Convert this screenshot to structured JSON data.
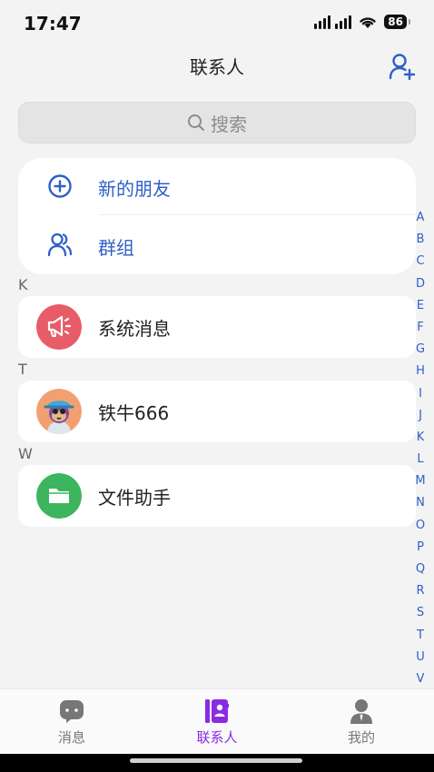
{
  "status": {
    "time": "17:47",
    "battery": "86"
  },
  "header": {
    "title": "联系人"
  },
  "search": {
    "placeholder": "搜索"
  },
  "top_items": [
    {
      "label": "新的朋友",
      "icon": "plus-circle-icon"
    },
    {
      "label": "群组",
      "icon": "group-icon"
    }
  ],
  "sections": [
    {
      "letter": "K",
      "contacts": [
        {
          "name": "系统消息",
          "avatar": "megaphone-avatar",
          "color": "#e85c67"
        }
      ]
    },
    {
      "letter": "T",
      "contacts": [
        {
          "name": "铁牛666",
          "avatar": "user-photo-avatar",
          "color": "#f2a071"
        }
      ]
    },
    {
      "letter": "W",
      "contacts": [
        {
          "name": "文件助手",
          "avatar": "folder-avatar",
          "color": "#3cb55e"
        }
      ]
    }
  ],
  "index_letters": [
    "A",
    "B",
    "C",
    "D",
    "E",
    "F",
    "G",
    "H",
    "I",
    "J",
    "K",
    "L",
    "M",
    "N",
    "O",
    "P",
    "Q",
    "R",
    "S",
    "T",
    "U",
    "V"
  ],
  "tabs": [
    {
      "label": "消息",
      "icon": "chat-icon",
      "active": false
    },
    {
      "label": "联系人",
      "icon": "contacts-book-icon",
      "active": true
    },
    {
      "label": "我的",
      "icon": "person-icon",
      "active": false
    }
  ],
  "colors": {
    "accent": "#2f5fc8",
    "tab_active": "#8a2be2"
  }
}
